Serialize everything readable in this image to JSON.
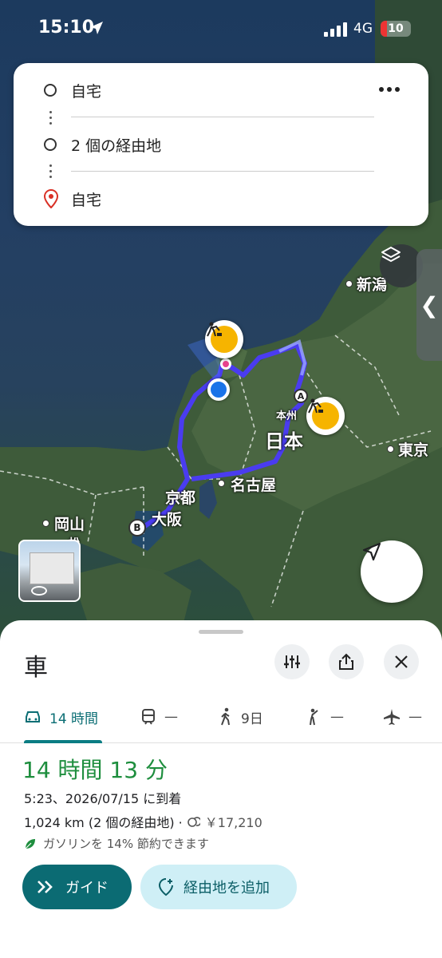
{
  "status_bar": {
    "time": "15:10",
    "network": "4G",
    "battery": "10"
  },
  "waypoints": {
    "origin": "自宅",
    "stops": "2 個の経由地",
    "destination": "自宅"
  },
  "map": {
    "labels": {
      "niigata": "新潟",
      "honshu": "本州",
      "japan": "日本",
      "tokyo": "東京",
      "nagoya": "名古屋",
      "kyoto": "京都",
      "osaka": "大阪",
      "okayama": "岡山",
      "matsu": "松"
    },
    "marker_a": "A",
    "marker_b": "B",
    "route_color": "#4a3cf0",
    "work_pin_color": "#f6b400"
  },
  "sheet": {
    "title": "車",
    "modes": [
      {
        "label": "14 時間",
        "icon": "car-icon"
      },
      {
        "label": "—",
        "icon": "train-icon"
      },
      {
        "label": "9日",
        "icon": "walk-icon"
      },
      {
        "label": "—",
        "icon": "ride-icon"
      },
      {
        "label": "—",
        "icon": "flight-icon"
      }
    ],
    "duration": "14 時間 13 分",
    "arrival": "5:23、2026/07/15 に到着",
    "distance": "1,024 km (2 個の経由地) ·",
    "fare": "￥17,210",
    "eco_note": "ガソリンを 14% 節約できます",
    "guide_button": "ガイド",
    "add_stop_button": "経由地を追加",
    "accent_color": "#0b6b73",
    "duration_color": "#1e8e3e"
  }
}
